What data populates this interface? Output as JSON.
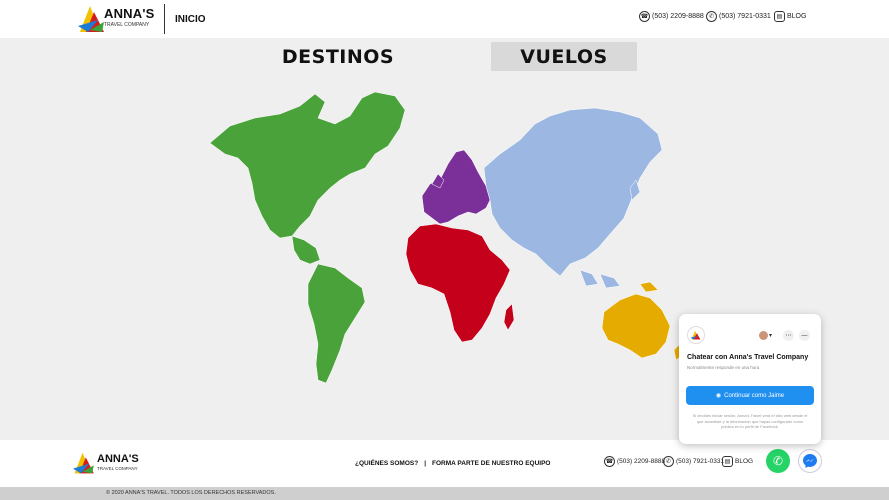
{
  "header": {
    "logo": {
      "name": "ANNA'S",
      "tagline": "TRAVEL COMPANY"
    },
    "nav_home": "INICIO",
    "phone1": "(503) 2209-8888",
    "phone2": "(503) 7921-0331",
    "blog": "BLOG"
  },
  "tabs": {
    "destinos": "DESTINOS",
    "vuelos": "VUELOS"
  },
  "map": {
    "regions": [
      {
        "name": "america",
        "color": "#4aa33a"
      },
      {
        "name": "europe",
        "color": "#7b2f99"
      },
      {
        "name": "africa",
        "color": "#c4001a"
      },
      {
        "name": "asia",
        "color": "#9bb7e2"
      },
      {
        "name": "oceania",
        "color": "#e5ab00"
      }
    ]
  },
  "footer": {
    "logo": {
      "name": "ANNA'S",
      "tagline": "TRAVEL COMPANY"
    },
    "about": "¿QUIÉNES SOMOS?",
    "sep": "|",
    "join": "FORMA PARTE DE NUESTRO EQUIPO",
    "phone1": "(503) 2209-8888",
    "phone2": "(503) 7921-0331",
    "blog": "BLOG",
    "copyright": "© 2020 ANNA'S TRAVEL. TODOS LOS DERECHOS RESERVADOS."
  },
  "chat": {
    "title": "Chatear con Anna's Travel Company",
    "subtitle": "Normalmente responde en una hora",
    "button": "Continuar como Jaime",
    "note": "Si decides iniciar sesión, Anna's Travel verá el sitio web desde el que accediste y la información que hayas configurado como pública en tu perfil de Facebook."
  }
}
